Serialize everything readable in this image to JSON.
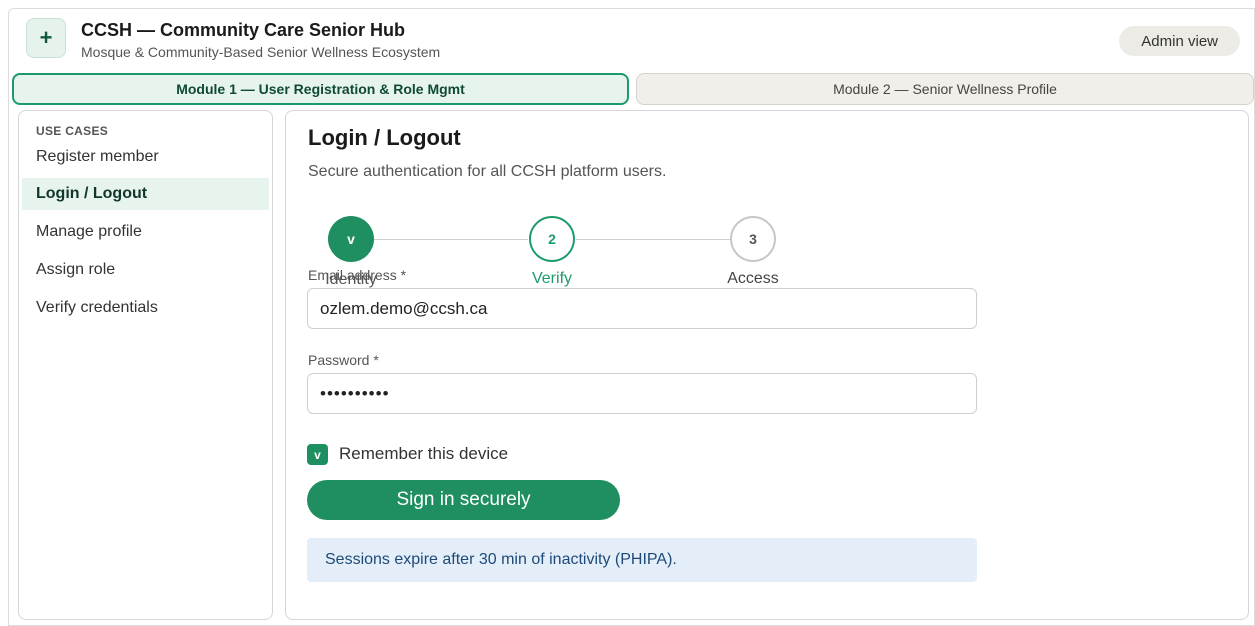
{
  "header": {
    "logo_glyph": "+",
    "title": "CCSH — Community Care Senior Hub",
    "subtitle": "Mosque & Community-Based Senior Wellness Ecosystem",
    "admin_view_label": "Admin view"
  },
  "modules": [
    {
      "label": "Module 1 — User Registration & Role Mgmt",
      "active": true
    },
    {
      "label": "Module 2 — Senior Wellness Profile",
      "active": false
    }
  ],
  "sidebar": {
    "heading": "USE CASES",
    "items": [
      {
        "label": "Register member"
      },
      {
        "label": "Login / Logout",
        "active": true
      },
      {
        "label": "Manage profile"
      },
      {
        "label": "Assign role"
      },
      {
        "label": "Verify credentials"
      }
    ]
  },
  "main": {
    "title": "Login / Logout",
    "description": "Secure authentication for all CCSH platform users.",
    "stepper": {
      "steps": [
        {
          "marker": "v",
          "label": "Identity",
          "state": "done"
        },
        {
          "marker": "2",
          "label": "Verify",
          "state": "current"
        },
        {
          "marker": "3",
          "label": "Access",
          "state": "todo"
        }
      ]
    },
    "email": {
      "label": "Email address *",
      "value": "ozlem.demo@ccsh.ca"
    },
    "password": {
      "label": "Password *",
      "value": "••••••••••"
    },
    "remember": {
      "mark": "v",
      "label": "Remember this device",
      "checked": true
    },
    "submit_label": "Sign in securely",
    "info_message": "Sessions expire after 30 min of inactivity (PHIPA)."
  },
  "colors": {
    "accent": "#1f8f62",
    "accent_light": "#e7f4ee",
    "info_bg": "#e4eef9",
    "info_text": "#1e4a78"
  }
}
